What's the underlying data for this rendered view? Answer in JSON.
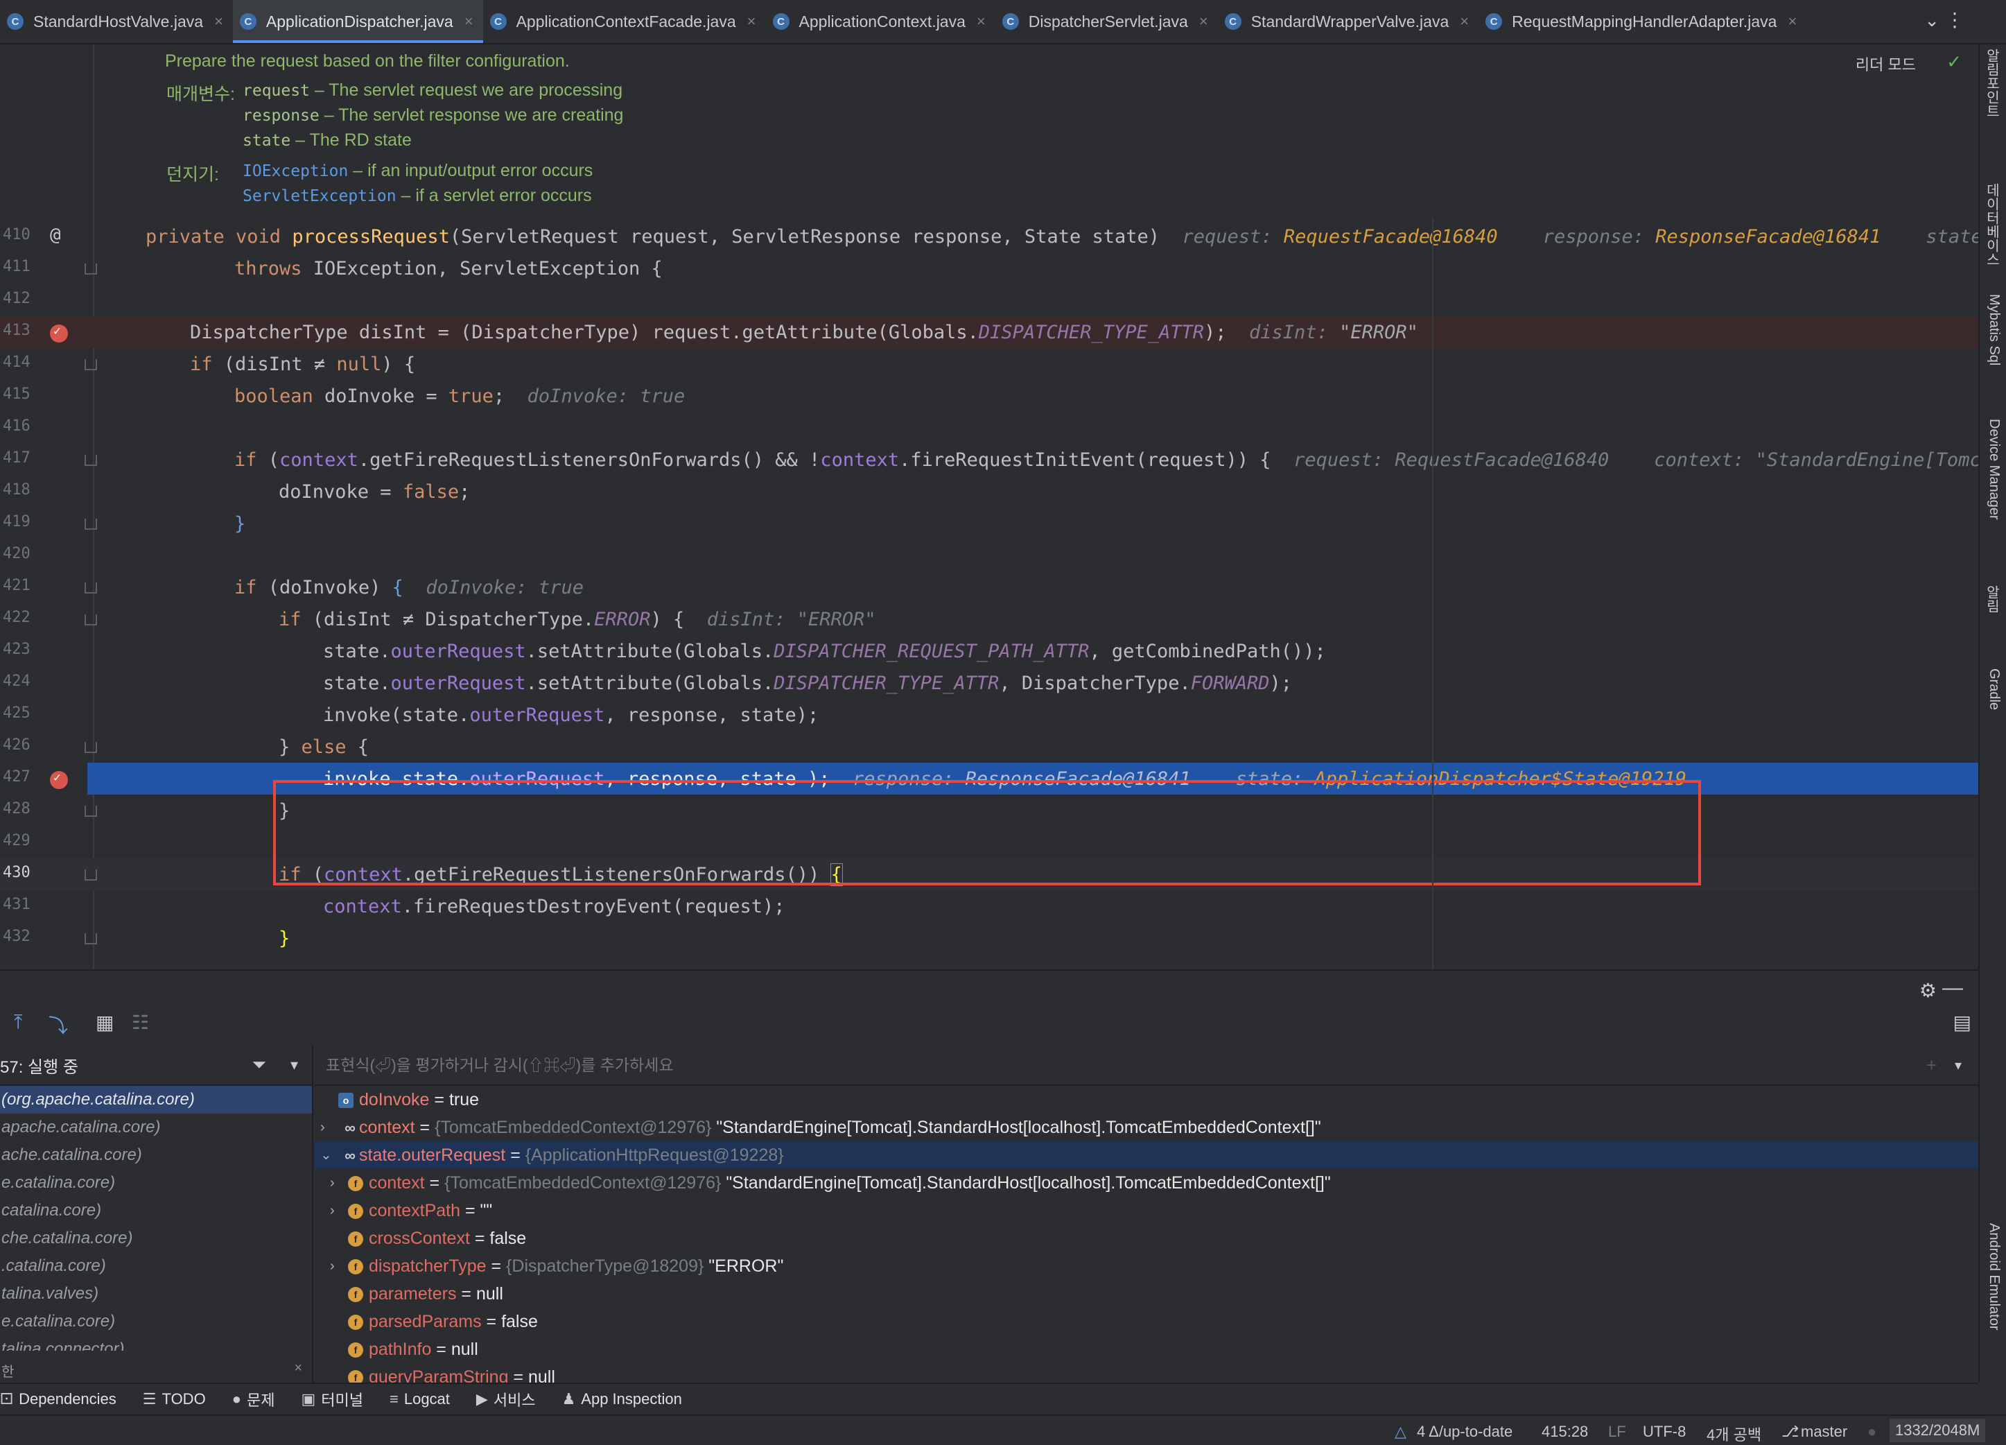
{
  "tabs": [
    {
      "label": "StandardHostValve.java",
      "active": false
    },
    {
      "label": "ApplicationDispatcher.java",
      "active": true
    },
    {
      "label": "ApplicationContextFacade.java",
      "active": false
    },
    {
      "label": "ApplicationContext.java",
      "active": false
    },
    {
      "label": "DispatcherServlet.java",
      "active": false
    },
    {
      "label": "StandardWrapperValve.java",
      "active": false
    },
    {
      "label": "RequestMappingHandlerAdapter.java",
      "active": false
    }
  ],
  "editor": {
    "reader_mode": "리더 모드",
    "doc": {
      "summary": "Prepare the request based on the filter configuration.",
      "params_label": "매개변수:",
      "params": [
        {
          "name": "request",
          "desc": " – The servlet request we are processing"
        },
        {
          "name": "response",
          "desc": " – The servlet response we are creating"
        },
        {
          "name": "state",
          "desc": " – The RD state"
        }
      ],
      "throws_label": "던지기:",
      "throws": [
        {
          "name": "IOException",
          "desc": " – if an input/output error occurs"
        },
        {
          "name": "ServletException",
          "desc": " – if a servlet error occurs"
        }
      ]
    },
    "line_numbers": [
      "410",
      "411",
      "412",
      "413",
      "414",
      "415",
      "416",
      "417",
      "418",
      "419",
      "420",
      "421",
      "422",
      "423",
      "424",
      "425",
      "426",
      "427",
      "428",
      "429",
      "430",
      "431",
      "432"
    ],
    "hints": {
      "l410_a": "request: ",
      "l410_b": "RequestFacade@16840",
      "l410_c": "response: ",
      "l410_d": "ResponseFacade@16841",
      "l410_e": "state:",
      "l413_a": "disInt: ",
      "l413_b": "\"ERROR\"",
      "l415_a": "doInvoke: ",
      "l415_b": "true",
      "l417_a": "request: ",
      "l417_b": "RequestFacade@16840",
      "l417_c": "context: ",
      "l417_d": "\"StandardEngine[Tomca",
      "l421_a": "doInvoke: ",
      "l421_b": "true",
      "l422_a": "disInt: ",
      "l422_b": "\"ERROR\"",
      "l427_a": "response: ",
      "l427_b": "ResponseFacade@16841",
      "l427_c": "state: ",
      "l427_d": "ApplicationDispatcher$State@19219"
    }
  },
  "right_strip": [
    "알림포인트",
    "데이터베이스",
    "Mybatis Sql",
    "Device Manager",
    "알림",
    "Gradle",
    "Android Emulator"
  ],
  "debug": {
    "frames_header": "57: 실행 중",
    "frames": [
      "(org.apache.catalina.core)",
      "apache.catalina.core)",
      "ache.catalina.core)",
      "e.catalina.core)",
      "catalina.core)",
      "che.catalina.core)",
      ".catalina.core)",
      "talina.valves)",
      "e.catalina.core)",
      "talina.connector)"
    ],
    "frames_footer": "한",
    "watch_placeholder": "표현식(⏎)을 평가하거나 감시(⇧⌘⏎)를 추가하세요",
    "vars": [
      {
        "name": "doInvoke",
        "eq": " = ",
        "value": "true",
        "type": "",
        "icon": "p",
        "arrow": "",
        "indent": 0,
        "selected": false
      },
      {
        "name": "context",
        "eq": " = ",
        "type": "{TomcatEmbeddedContext@12976} ",
        "value": "\"StandardEngine[Tomcat].StandardHost[localhost].TomcatEmbeddedContext[]\"",
        "icon": "w",
        "arrow": "›",
        "indent": 0,
        "selected": false
      },
      {
        "name": "state.outerRequest",
        "eq": " = ",
        "type": "{ApplicationHttpRequest@19228}",
        "value": "",
        "icon": "w",
        "arrow": "⌄",
        "indent": 0,
        "selected": true
      },
      {
        "name": "context",
        "eq": " = ",
        "type": "{TomcatEmbeddedContext@12976} ",
        "value": "\"StandardEngine[Tomcat].StandardHost[localhost].TomcatEmbeddedContext[]\"",
        "icon": "f",
        "arrow": "›",
        "indent": 1,
        "selected": false
      },
      {
        "name": "contextPath",
        "eq": " = ",
        "type": "",
        "value": "\"\"",
        "icon": "f",
        "arrow": "›",
        "indent": 1,
        "selected": false
      },
      {
        "name": "crossContext",
        "eq": " = ",
        "type": "",
        "value": "false",
        "icon": "f",
        "arrow": "",
        "indent": 1,
        "selected": false
      },
      {
        "name": "dispatcherType",
        "eq": " = ",
        "type": "{DispatcherType@18209} ",
        "value": "\"ERROR\"",
        "icon": "f",
        "arrow": "›",
        "indent": 1,
        "selected": false
      },
      {
        "name": "parameters",
        "eq": " = ",
        "type": "",
        "value": "null",
        "icon": "f",
        "arrow": "",
        "indent": 1,
        "selected": false
      },
      {
        "name": "parsedParams",
        "eq": " = ",
        "type": "",
        "value": "false",
        "icon": "f",
        "arrow": "",
        "indent": 1,
        "selected": false
      },
      {
        "name": "pathInfo",
        "eq": " = ",
        "type": "",
        "value": "null",
        "icon": "f",
        "arrow": "",
        "indent": 1,
        "selected": false
      },
      {
        "name": "queryParamString",
        "eq": " = ",
        "type": "",
        "value": "null",
        "icon": "f",
        "arrow": "",
        "indent": 1,
        "selected": false
      }
    ]
  },
  "bottom_tools": [
    {
      "glyph": "",
      "label": "Dependencies"
    },
    {
      "glyph": "☰",
      "label": "TODO"
    },
    {
      "glyph": "●",
      "label": "문제"
    },
    {
      "glyph": "▣",
      "label": "터미널"
    },
    {
      "glyph": "≡",
      "label": "Logcat"
    },
    {
      "glyph": "▶",
      "label": "서비스"
    },
    {
      "glyph": "♟",
      "label": "App Inspection"
    }
  ],
  "status": {
    "vcs": "4 Δ/up-to-date",
    "position": "415:28",
    "line_sep": "LF",
    "encoding": "UTF-8",
    "indent": "4개 공백",
    "branch": "master",
    "memory": "1332/2048M"
  },
  "colors": {
    "accent": "#5a8dee",
    "breakpoint": "#d8564e",
    "selection": "#2154a5",
    "highlight_box": "#e8473e"
  }
}
